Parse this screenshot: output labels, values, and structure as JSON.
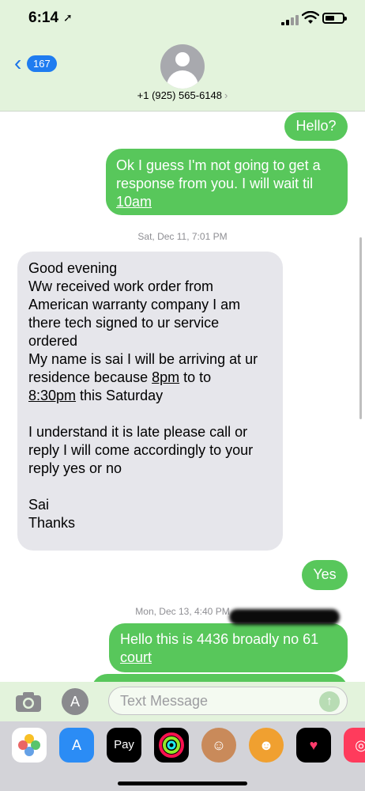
{
  "status": {
    "time": "6:14"
  },
  "header": {
    "back_count": "167",
    "contact": "+1 (925) 565-6148"
  },
  "messages": [
    {
      "kind": "out",
      "text": "Hello?"
    },
    {
      "kind": "out",
      "lines": [
        "Ok I guess I'm not going to get a",
        "response from you. I will wait til"
      ],
      "link": "10am"
    },
    {
      "kind": "timestamp",
      "text": "Sat, Dec 11, 7:01 PM"
    },
    {
      "kind": "in",
      "line1": "Good evening",
      "line2": "Ww received work order from",
      "line3": "American warranty company I am",
      "line4": "there tech signed to ur service",
      "line5": "ordered",
      "line6": "My name is sai I will be arriving at ur",
      "line7_pre": "residence because ",
      "line7_link": "8pm",
      "line7_post": " to to",
      "line8_link": "8:30pm",
      "line8_post": " this  Saturday",
      "line9": "I understand it is late please call or",
      "line10": "reply I will come accordingly to your",
      "line11": "reply yes or no",
      "line12": "Sai",
      "line13": "Thanks"
    },
    {
      "kind": "out",
      "text": "Yes"
    },
    {
      "kind": "timestamp",
      "text": "Mon, Dec 13, 4:40 PM"
    },
    {
      "kind": "out",
      "pre": "Hello this is ",
      "hidden": "4436 broadly no 61",
      "link": "court"
    }
  ],
  "input": {
    "placeholder": "Text Message"
  },
  "apps": [
    {
      "name": "photos-icon"
    },
    {
      "name": "app-store-icon"
    },
    {
      "name": "apple-pay-icon",
      "label": "Pay"
    },
    {
      "name": "activity-icon"
    },
    {
      "name": "memoji-icon"
    },
    {
      "name": "animoji-icon"
    },
    {
      "name": "digital-touch-icon"
    },
    {
      "name": "web-icon"
    }
  ]
}
